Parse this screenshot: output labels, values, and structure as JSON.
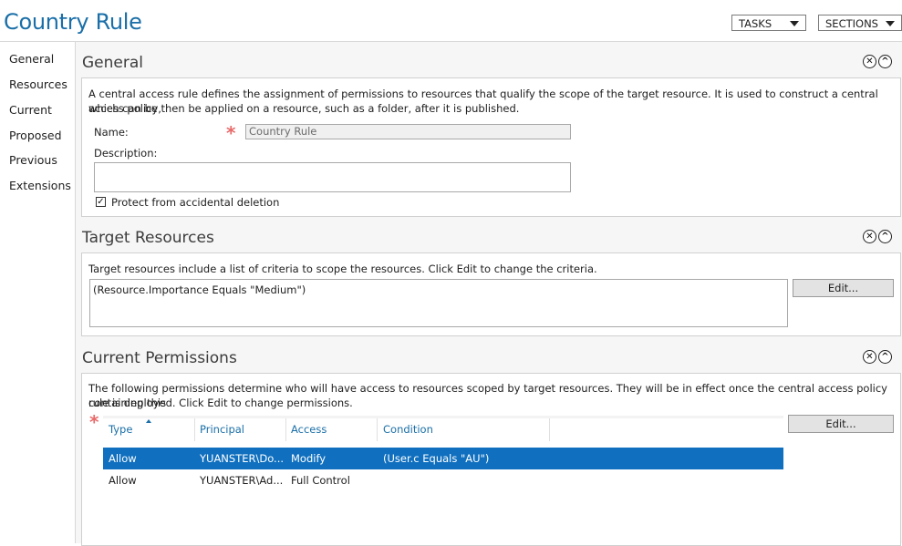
{
  "header": {
    "title": "Country Rule",
    "tasks_label": "TASKS",
    "sections_label": "SECTIONS"
  },
  "nav": {
    "items": [
      {
        "label": "General"
      },
      {
        "label": "Resources"
      },
      {
        "label": "Current"
      },
      {
        "label": "Proposed"
      },
      {
        "label": "Previous"
      },
      {
        "label": "Extensions"
      }
    ]
  },
  "general": {
    "title": "General",
    "description": "A central access rule defines the assignment of permissions to resources that qualify the scope of the target resource. It is used to construct a central access policy,",
    "description_line2": "which can be then be applied on a resource, such as a folder, after it is published.",
    "name_label": "Name:",
    "name_value": "Country Rule",
    "description_label": "Description:",
    "description_value": "",
    "protect_label": "Protect from accidental deletion",
    "protect_checked": true
  },
  "target_resources": {
    "title": "Target Resources",
    "description": "Target resources include a list of criteria to scope the resources. Click Edit to change the criteria.",
    "criteria": "(Resource.Importance Equals \"Medium\")",
    "edit_label": "Edit..."
  },
  "current_permissions": {
    "title": "Current Permissions",
    "description": "The following permissions determine who will have access to resources scoped by target resources. They will be in effect once the central access policy containing this",
    "description_line2": "rule is deployed. Click Edit to change permissions.",
    "edit_label": "Edit...",
    "columns": [
      "Type",
      "Principal",
      "Access",
      "Condition"
    ],
    "rows": [
      {
        "type": "Allow",
        "principal": "YUANSTER\\Do...",
        "access": "Modify",
        "condition": "(User.c Equals \"AU\")",
        "selected": true
      },
      {
        "type": "Allow",
        "principal": "YUANSTER\\Ad...",
        "access": "Full Control",
        "condition": "",
        "selected": false
      }
    ]
  },
  "colors": {
    "accent": "#1a6fa8",
    "selection": "#1070bf",
    "required": "#e86a6a"
  }
}
